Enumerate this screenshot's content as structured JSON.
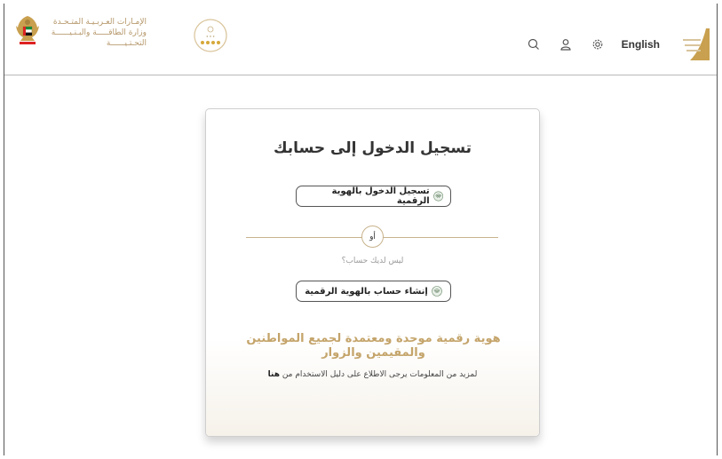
{
  "header": {
    "ministry_line1": "الإمـارات العـربـيـة المتـحـدة",
    "ministry_line2": "وزارة الطاقـــــة والبـنـيــــــة التحـتـيــــــة",
    "language_link": "English",
    "icons": [
      "search-icon",
      "user-icon",
      "gear-icon"
    ],
    "accent_color": "#b5976a"
  },
  "login_card": {
    "title": "تسجيل الدخول إلى حسابك",
    "login_uaepass_label": "تسجيل الدخول بالهوية الرقمية",
    "or_label": "أو",
    "no_account_text": "ليس لديك حساب؟",
    "create_uaepass_label": "إنشاء حساب بالهوية الرقمية",
    "tagline": "هوية رقمية موحدة ومعتمدة لجميع المواطنين والمقيمين والزوار",
    "info_text": "لمزيد من المعلومات يرجى الاطلاع على دليل الاستخدام من",
    "info_link": "هنا",
    "tagline_color": "#c4a46a",
    "divider_color": "#c8b38c"
  }
}
